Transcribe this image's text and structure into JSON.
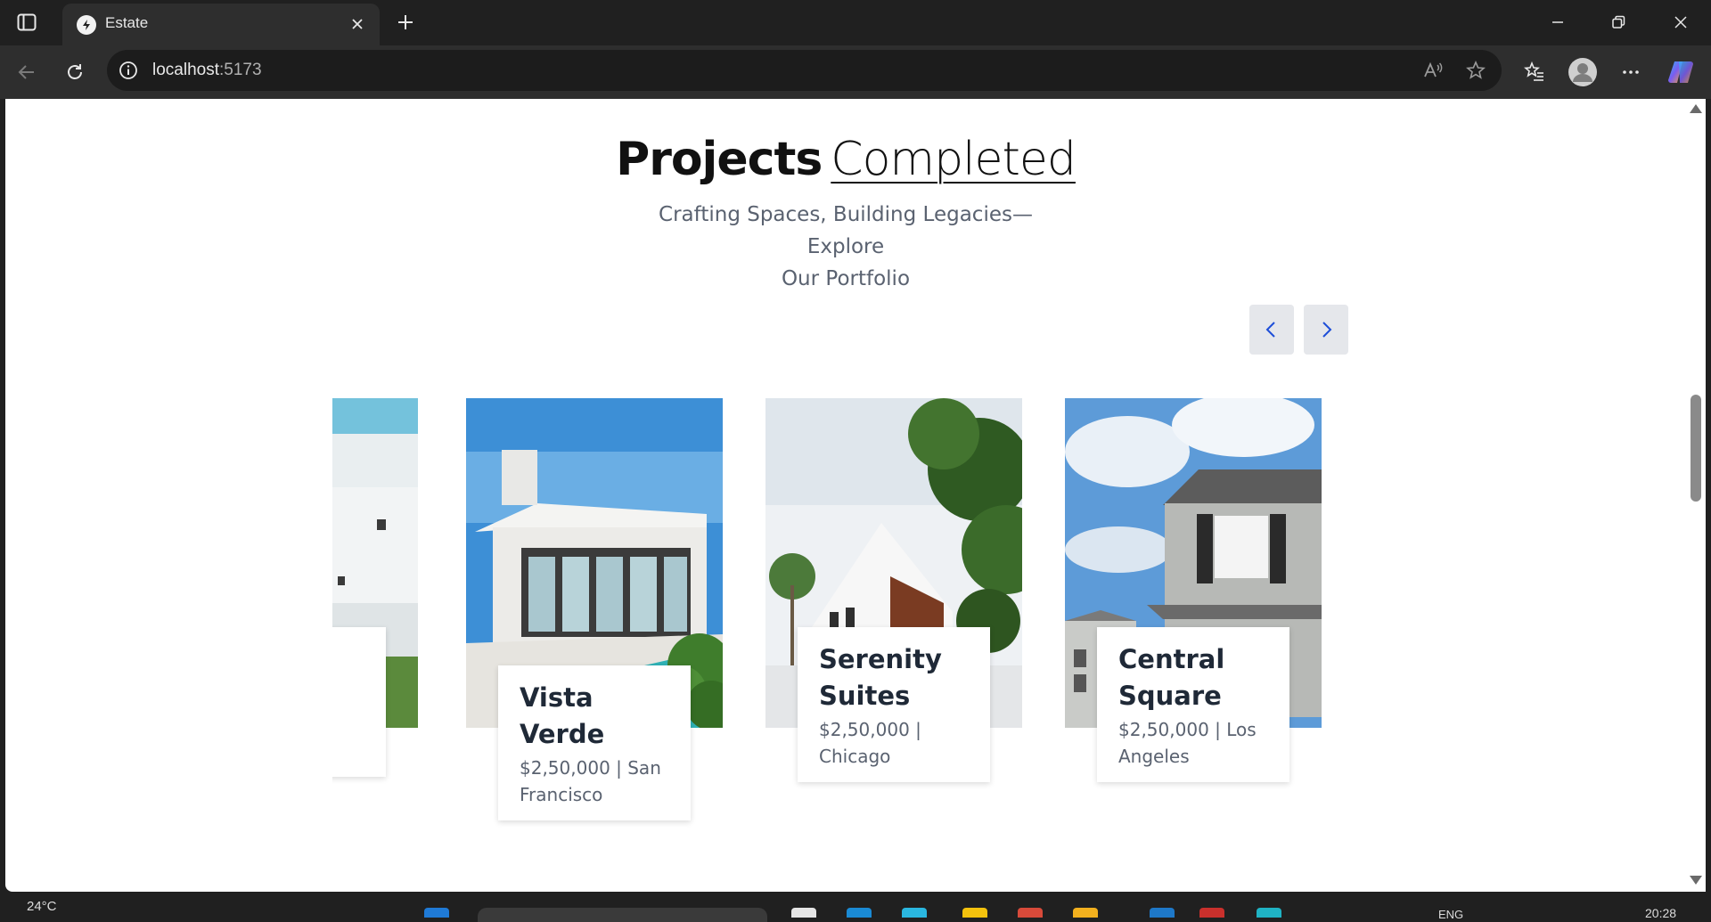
{
  "browser": {
    "tab_title": "Estate",
    "address_host": "localhost",
    "address_port": ":5173"
  },
  "page": {
    "heading_bold": "Projects",
    "heading_light": "Completed",
    "subtitle_line1": "Crafting Spaces, Building Legacies—Explore",
    "subtitle_line2": "Our Portfolio"
  },
  "projects": [
    {
      "title": "",
      "meta": ""
    },
    {
      "title": "Vista Verde",
      "meta": "$2,50,000 | San Francisco"
    },
    {
      "title": "Serenity Suites",
      "meta": "$2,50,000 | Chicago"
    },
    {
      "title": "Central Square",
      "meta": "$2,50,000 | Los Angeles"
    }
  ],
  "taskbar": {
    "weather": "24°C",
    "lang": "ENG",
    "time": "20:28"
  },
  "colors": {
    "accent": "#1d4ed8",
    "nav_button_bg": "#e5e7eb",
    "heading": "#111111",
    "muted_text": "#5a6270"
  }
}
